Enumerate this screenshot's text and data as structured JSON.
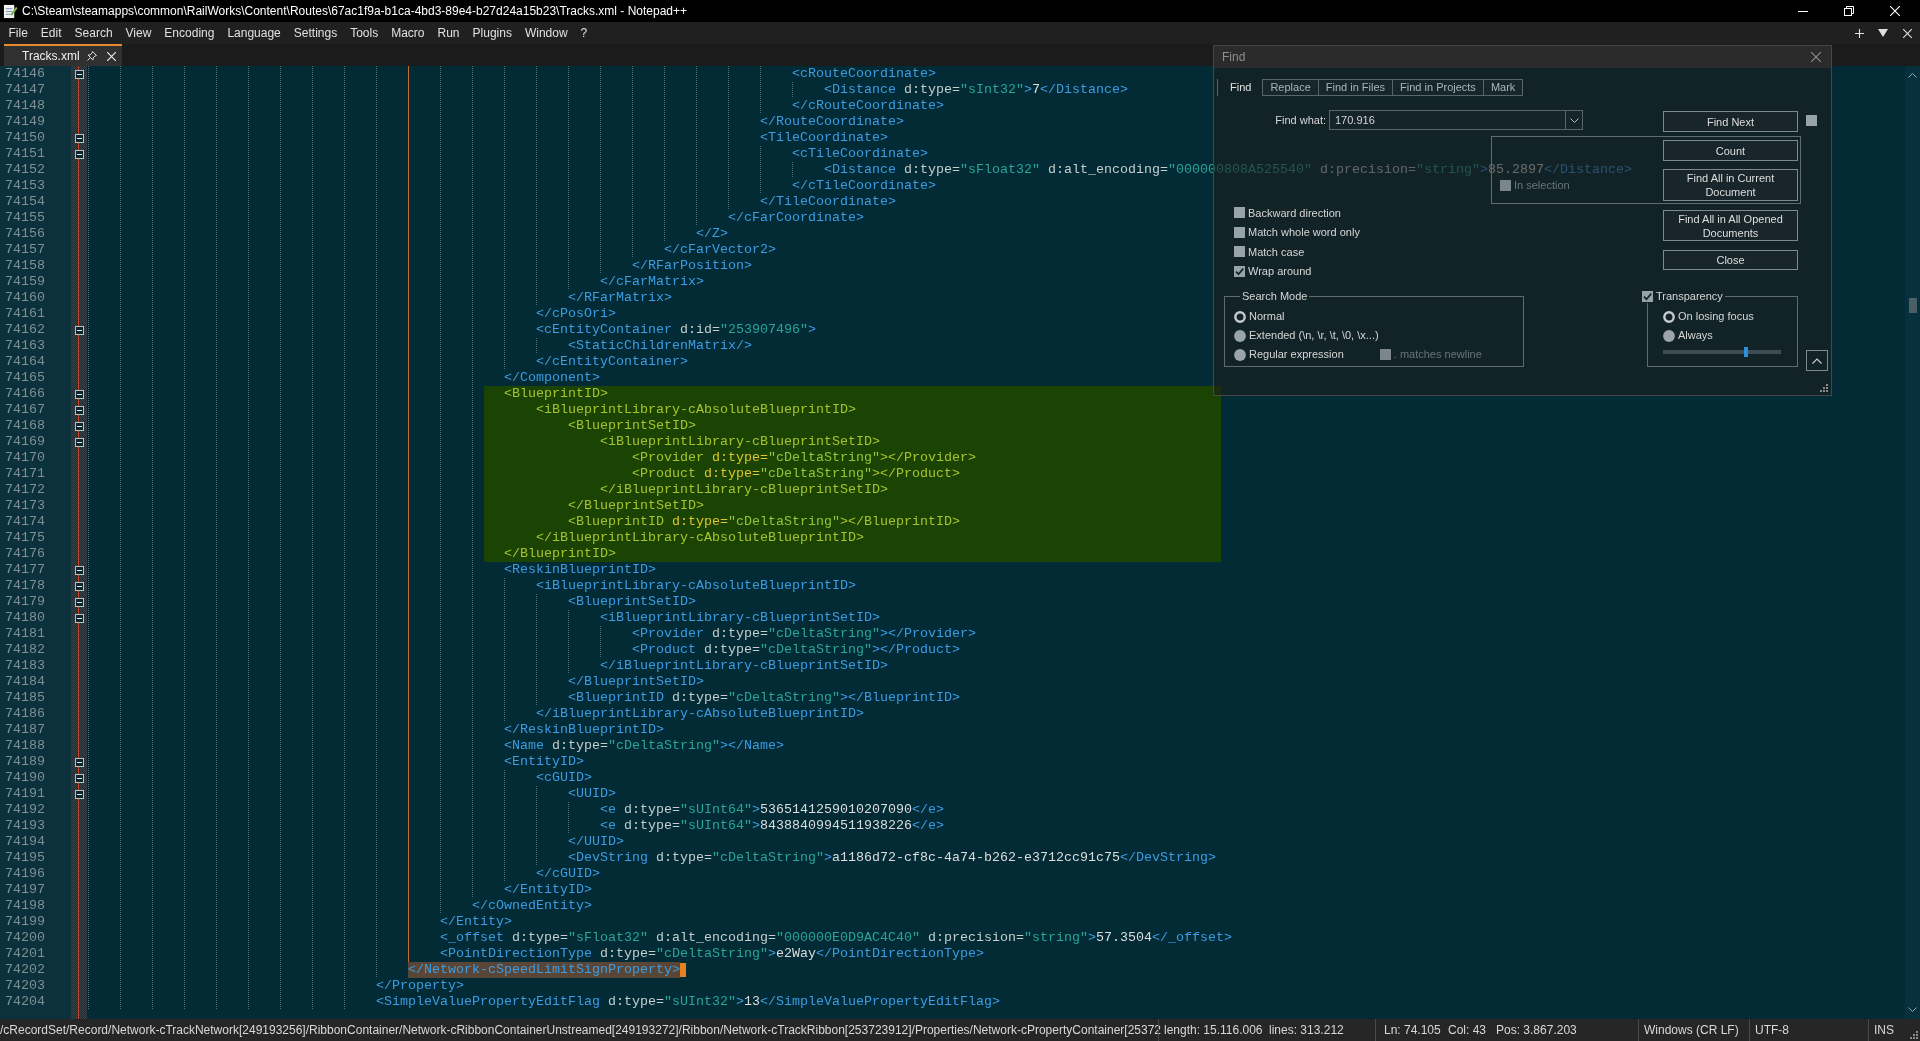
{
  "window": {
    "title": "C:\\Steam\\steamapps\\common\\RailWorks\\Content\\Routes\\67ac1f9a-b1ca-4bd3-89e4-b27d24a15b23\\Tracks.xml - Notepad++"
  },
  "menu": [
    "File",
    "Edit",
    "Search",
    "View",
    "Encoding",
    "Language",
    "Settings",
    "Tools",
    "Macro",
    "Run",
    "Plugins",
    "Window",
    "?"
  ],
  "tabs": [
    {
      "label": "Tracks.xml",
      "selected": true
    }
  ],
  "editor": {
    "lines": [
      {
        "number": "74146",
        "text": "\t\t\t\t\t\t\t\t\t\t\t\t\t\t\t\t\t\t\t\t\t\t<cRouteCoordinate>",
        "fold_marker": true,
        "highlighted": false,
        "selected": false
      },
      {
        "number": "74147",
        "text": "\t\t\t\t\t\t\t\t\t\t\t\t\t\t\t\t\t\t\t\t\t\t\t<Distance d:type=\"sInt32\">7</Distance>",
        "fold_marker": false,
        "highlighted": false,
        "selected": false
      },
      {
        "number": "74148",
        "text": "\t\t\t\t\t\t\t\t\t\t\t\t\t\t\t\t\t\t\t\t\t\t</cRouteCoordinate>",
        "fold_marker": false,
        "highlighted": false,
        "selected": false
      },
      {
        "number": "74149",
        "text": "\t\t\t\t\t\t\t\t\t\t\t\t\t\t\t\t\t\t\t\t\t</RouteCoordinate>",
        "fold_marker": false,
        "highlighted": false,
        "selected": false
      },
      {
        "number": "74150",
        "text": "\t\t\t\t\t\t\t\t\t\t\t\t\t\t\t\t\t\t\t\t\t<TileCoordinate>",
        "fold_marker": true,
        "highlighted": false,
        "selected": false
      },
      {
        "number": "74151",
        "text": "\t\t\t\t\t\t\t\t\t\t\t\t\t\t\t\t\t\t\t\t\t\t<cTileCoordinate>",
        "fold_marker": true,
        "highlighted": false,
        "selected": false
      },
      {
        "number": "74152",
        "text": "\t\t\t\t\t\t\t\t\t\t\t\t\t\t\t\t\t\t\t\t\t\t\t<Distance d:type=\"sFloat32\" d:alt_encoding=\"000000808A525540\" d:precision=\"string\">85.2897</Distance>",
        "fold_marker": false,
        "highlighted": false,
        "selected": false
      },
      {
        "number": "74153",
        "text": "\t\t\t\t\t\t\t\t\t\t\t\t\t\t\t\t\t\t\t\t\t\t</cTileCoordinate>",
        "fold_marker": false,
        "highlighted": false,
        "selected": false
      },
      {
        "number": "74154",
        "text": "\t\t\t\t\t\t\t\t\t\t\t\t\t\t\t\t\t\t\t\t\t</TileCoordinate>",
        "fold_marker": false,
        "highlighted": false,
        "selected": false
      },
      {
        "number": "74155",
        "text": "\t\t\t\t\t\t\t\t\t\t\t\t\t\t\t\t\t\t\t\t</cFarCoordinate>",
        "fold_marker": false,
        "highlighted": false,
        "selected": false
      },
      {
        "number": "74156",
        "text": "\t\t\t\t\t\t\t\t\t\t\t\t\t\t\t\t\t\t\t</Z>",
        "fold_marker": false,
        "highlighted": false,
        "selected": false
      },
      {
        "number": "74157",
        "text": "\t\t\t\t\t\t\t\t\t\t\t\t\t\t\t\t\t\t</cFarVector2>",
        "fold_marker": false,
        "highlighted": false,
        "selected": false
      },
      {
        "number": "74158",
        "text": "\t\t\t\t\t\t\t\t\t\t\t\t\t\t\t\t\t</RFarPosition>",
        "fold_marker": false,
        "highlighted": false,
        "selected": false
      },
      {
        "number": "74159",
        "text": "\t\t\t\t\t\t\t\t\t\t\t\t\t\t\t\t</cFarMatrix>",
        "fold_marker": false,
        "highlighted": false,
        "selected": false
      },
      {
        "number": "74160",
        "text": "\t\t\t\t\t\t\t\t\t\t\t\t\t\t\t</RFarMatrix>",
        "fold_marker": false,
        "highlighted": false,
        "selected": false
      },
      {
        "number": "74161",
        "text": "\t\t\t\t\t\t\t\t\t\t\t\t\t\t</cPosOri>",
        "fold_marker": false,
        "highlighted": false,
        "selected": false
      },
      {
        "number": "74162",
        "text": "\t\t\t\t\t\t\t\t\t\t\t\t\t\t<cEntityContainer d:id=\"253907496\">",
        "fold_marker": true,
        "highlighted": false,
        "selected": false
      },
      {
        "number": "74163",
        "text": "\t\t\t\t\t\t\t\t\t\t\t\t\t\t\t<StaticChildrenMatrix/>",
        "fold_marker": false,
        "highlighted": false,
        "selected": false
      },
      {
        "number": "74164",
        "text": "\t\t\t\t\t\t\t\t\t\t\t\t\t\t</cEntityContainer>",
        "fold_marker": false,
        "highlighted": false,
        "selected": false
      },
      {
        "number": "74165",
        "text": "\t\t\t\t\t\t\t\t\t\t\t\t\t</Component>",
        "fold_marker": false,
        "highlighted": false,
        "selected": false
      },
      {
        "number": "74166",
        "text": "\t\t\t\t\t\t\t\t\t\t\t\t\t<BlueprintID>",
        "fold_marker": true,
        "highlighted": true,
        "selected": false
      },
      {
        "number": "74167",
        "text": "\t\t\t\t\t\t\t\t\t\t\t\t\t\t<iBlueprintLibrary-cAbsoluteBlueprintID>",
        "fold_marker": true,
        "highlighted": true,
        "selected": false
      },
      {
        "number": "74168",
        "text": "\t\t\t\t\t\t\t\t\t\t\t\t\t\t\t<BlueprintSetID>",
        "fold_marker": true,
        "highlighted": true,
        "selected": false
      },
      {
        "number": "74169",
        "text": "\t\t\t\t\t\t\t\t\t\t\t\t\t\t\t\t<iBlueprintLibrary-cBlueprintSetID>",
        "fold_marker": true,
        "highlighted": true,
        "selected": false
      },
      {
        "number": "74170",
        "text": "\t\t\t\t\t\t\t\t\t\t\t\t\t\t\t\t\t<Provider d:type=\"cDeltaString\"></Provider>",
        "fold_marker": false,
        "highlighted": true,
        "selected": false
      },
      {
        "number": "74171",
        "text": "\t\t\t\t\t\t\t\t\t\t\t\t\t\t\t\t\t<Product d:type=\"cDeltaString\"></Product>",
        "fold_marker": false,
        "highlighted": true,
        "selected": false
      },
      {
        "number": "74172",
        "text": "\t\t\t\t\t\t\t\t\t\t\t\t\t\t\t\t</iBlueprintLibrary-cBlueprintSetID>",
        "fold_marker": false,
        "highlighted": true,
        "selected": false
      },
      {
        "number": "74173",
        "text": "\t\t\t\t\t\t\t\t\t\t\t\t\t\t\t</BlueprintSetID>",
        "fold_marker": false,
        "highlighted": true,
        "selected": false
      },
      {
        "number": "74174",
        "text": "\t\t\t\t\t\t\t\t\t\t\t\t\t\t\t<BlueprintID d:type=\"cDeltaString\"></BlueprintID>",
        "fold_marker": false,
        "highlighted": true,
        "selected": false
      },
      {
        "number": "74175",
        "text": "\t\t\t\t\t\t\t\t\t\t\t\t\t\t</iBlueprintLibrary-cAbsoluteBlueprintID>",
        "fold_marker": false,
        "highlighted": true,
        "selected": false
      },
      {
        "number": "74176",
        "text": "\t\t\t\t\t\t\t\t\t\t\t\t\t</BlueprintID>",
        "fold_marker": false,
        "highlighted": true,
        "selected": false
      },
      {
        "number": "74177",
        "text": "\t\t\t\t\t\t\t\t\t\t\t\t\t<ReskinBlueprintID>",
        "fold_marker": true,
        "highlighted": false,
        "selected": false
      },
      {
        "number": "74178",
        "text": "\t\t\t\t\t\t\t\t\t\t\t\t\t\t<iBlueprintLibrary-cAbsoluteBlueprintID>",
        "fold_marker": true,
        "highlighted": false,
        "selected": false
      },
      {
        "number": "74179",
        "text": "\t\t\t\t\t\t\t\t\t\t\t\t\t\t\t<BlueprintSetID>",
        "fold_marker": true,
        "highlighted": false,
        "selected": false
      },
      {
        "number": "74180",
        "text": "\t\t\t\t\t\t\t\t\t\t\t\t\t\t\t\t<iBlueprintLibrary-cBlueprintSetID>",
        "fold_marker": true,
        "highlighted": false,
        "selected": false
      },
      {
        "number": "74181",
        "text": "\t\t\t\t\t\t\t\t\t\t\t\t\t\t\t\t\t<Provider d:type=\"cDeltaString\"></Provider>",
        "fold_marker": false,
        "highlighted": false,
        "selected": false
      },
      {
        "number": "74182",
        "text": "\t\t\t\t\t\t\t\t\t\t\t\t\t\t\t\t\t<Product d:type=\"cDeltaString\"></Product>",
        "fold_marker": false,
        "highlighted": false,
        "selected": false
      },
      {
        "number": "74183",
        "text": "\t\t\t\t\t\t\t\t\t\t\t\t\t\t\t\t</iBlueprintLibrary-cBlueprintSetID>",
        "fold_marker": false,
        "highlighted": false,
        "selected": false
      },
      {
        "number": "74184",
        "text": "\t\t\t\t\t\t\t\t\t\t\t\t\t\t\t</BlueprintSetID>",
        "fold_marker": false,
        "highlighted": false,
        "selected": false
      },
      {
        "number": "74185",
        "text": "\t\t\t\t\t\t\t\t\t\t\t\t\t\t\t<BlueprintID d:type=\"cDeltaString\"></BlueprintID>",
        "fold_marker": false,
        "highlighted": false,
        "selected": false
      },
      {
        "number": "74186",
        "text": "\t\t\t\t\t\t\t\t\t\t\t\t\t\t</iBlueprintLibrary-cAbsoluteBlueprintID>",
        "fold_marker": false,
        "highlighted": false,
        "selected": false
      },
      {
        "number": "74187",
        "text": "\t\t\t\t\t\t\t\t\t\t\t\t\t</ReskinBlueprintID>",
        "fold_marker": false,
        "highlighted": false,
        "selected": false
      },
      {
        "number": "74188",
        "text": "\t\t\t\t\t\t\t\t\t\t\t\t\t<Name d:type=\"cDeltaString\"></Name>",
        "fold_marker": false,
        "highlighted": false,
        "selected": false
      },
      {
        "number": "74189",
        "text": "\t\t\t\t\t\t\t\t\t\t\t\t\t<EntityID>",
        "fold_marker": true,
        "highlighted": false,
        "selected": false
      },
      {
        "number": "74190",
        "text": "\t\t\t\t\t\t\t\t\t\t\t\t\t\t<cGUID>",
        "fold_marker": true,
        "highlighted": false,
        "selected": false
      },
      {
        "number": "74191",
        "text": "\t\t\t\t\t\t\t\t\t\t\t\t\t\t\t<UUID>",
        "fold_marker": true,
        "highlighted": false,
        "selected": false
      },
      {
        "number": "74192",
        "text": "\t\t\t\t\t\t\t\t\t\t\t\t\t\t\t\t<e d:type=\"sUInt64\">5365141259010207090</e>",
        "fold_marker": false,
        "highlighted": false,
        "selected": false
      },
      {
        "number": "74193",
        "text": "\t\t\t\t\t\t\t\t\t\t\t\t\t\t\t\t<e d:type=\"sUInt64\">8438840994511938226</e>",
        "fold_marker": false,
        "highlighted": false,
        "selected": false
      },
      {
        "number": "74194",
        "text": "\t\t\t\t\t\t\t\t\t\t\t\t\t\t\t</UUID>",
        "fold_marker": false,
        "highlighted": false,
        "selected": false
      },
      {
        "number": "74195",
        "text": "\t\t\t\t\t\t\t\t\t\t\t\t\t\t\t<DevString d:type=\"cDeltaString\">a1186d72-cf8c-4a74-b262-e3712cc91c75</DevString>",
        "fold_marker": false,
        "highlighted": false,
        "selected": false
      },
      {
        "number": "74196",
        "text": "\t\t\t\t\t\t\t\t\t\t\t\t\t\t</cGUID>",
        "fold_marker": false,
        "highlighted": false,
        "selected": false
      },
      {
        "number": "74197",
        "text": "\t\t\t\t\t\t\t\t\t\t\t\t\t</EntityID>",
        "fold_marker": false,
        "highlighted": false,
        "selected": false
      },
      {
        "number": "74198",
        "text": "\t\t\t\t\t\t\t\t\t\t\t\t</cOwnedEntity>",
        "fold_marker": false,
        "highlighted": false,
        "selected": false
      },
      {
        "number": "74199",
        "text": "\t\t\t\t\t\t\t\t\t\t\t</Entity>",
        "fold_marker": false,
        "highlighted": false,
        "selected": false
      },
      {
        "number": "74200",
        "text": "\t\t\t\t\t\t\t\t\t\t\t<_offset d:type=\"sFloat32\" d:alt_encoding=\"000000E0D9AC4C40\" d:precision=\"string\">57.3504</_offset>",
        "fold_marker": false,
        "highlighted": false,
        "selected": false
      },
      {
        "number": "74201",
        "text": "\t\t\t\t\t\t\t\t\t\t\t<PointDirectionType d:type=\"cDeltaString\">e2Way</PointDirectionType>",
        "fold_marker": false,
        "highlighted": false,
        "selected": false
      },
      {
        "number": "74202",
        "text": "\t\t\t\t\t\t\t\t\t\t</Network-cSpeedLimitSignProperty>",
        "fold_marker": false,
        "highlighted": false,
        "selected": true
      },
      {
        "number": "74203",
        "text": "\t\t\t\t\t\t\t\t\t</Property>",
        "fold_marker": false,
        "highlighted": false,
        "selected": false
      },
      {
        "number": "74204",
        "text": "\t\t\t\t\t\t\t\t\t<SimpleValuePropertyEditFlag d:type=\"sUInt32\">13</SimpleValuePropertyEditFlag>",
        "fold_marker": false,
        "highlighted": false,
        "selected": false
      }
    ]
  },
  "find_dialog": {
    "title": "Find",
    "tabs": [
      {
        "label": "Find",
        "selected": true
      },
      {
        "label": "Replace",
        "selected": false
      },
      {
        "label": "Find in Files",
        "selected": false
      },
      {
        "label": "Find in Projects",
        "selected": false
      },
      {
        "label": "Mark",
        "selected": false
      }
    ],
    "find_what": {
      "label": "Find what:",
      "value": "170.916"
    },
    "buttons": [
      "Find Next",
      "Count",
      "Find All in Current Document",
      "Find All in All Opened Documents",
      "Close"
    ],
    "corner_checkbox": {
      "checked": false
    },
    "in_selection": {
      "label": "In selection",
      "checked": false,
      "disabled": true
    },
    "options": [
      {
        "label": "Backward direction",
        "checked": false
      },
      {
        "label": "Match whole word only",
        "checked": false
      },
      {
        "label": "Match case",
        "checked": false
      },
      {
        "label": "Wrap around",
        "checked": true
      }
    ],
    "search_mode": {
      "title": "Search Mode",
      "modes": [
        {
          "label": "Normal",
          "selected": true
        },
        {
          "label": "Extended (\\n, \\r, \\t, \\0, \\x...)",
          "selected": false
        },
        {
          "label": "Regular expression",
          "selected": false
        }
      ],
      "matches_newline": {
        "label": ". matches newline",
        "checked": false,
        "disabled": true
      }
    },
    "transparency": {
      "label": "Transparency",
      "checked": true,
      "modes": [
        {
          "label": "On losing focus",
          "selected": true
        },
        {
          "label": "Always",
          "selected": false
        }
      ],
      "level": 0.7
    }
  },
  "status_bar": {
    "path": "/cRecordSet/Record/Network-cTrackNetwork[249193256]/RibbonContainer/Network-cRibbonContainerUnstreamed[249193272]/Ribbon/Network-cTrackRibbon[253723912]/Properties/Network-cPropertyContainer[25372",
    "length": "length: 15.116.006",
    "lines": "lines: 313.212",
    "line": "Ln: 74.105",
    "column": "Col: 43",
    "position": "Pos: 3.867.203",
    "eol": "Windows (CR LF)",
    "encoding": "UTF-8",
    "mode": "INS"
  }
}
